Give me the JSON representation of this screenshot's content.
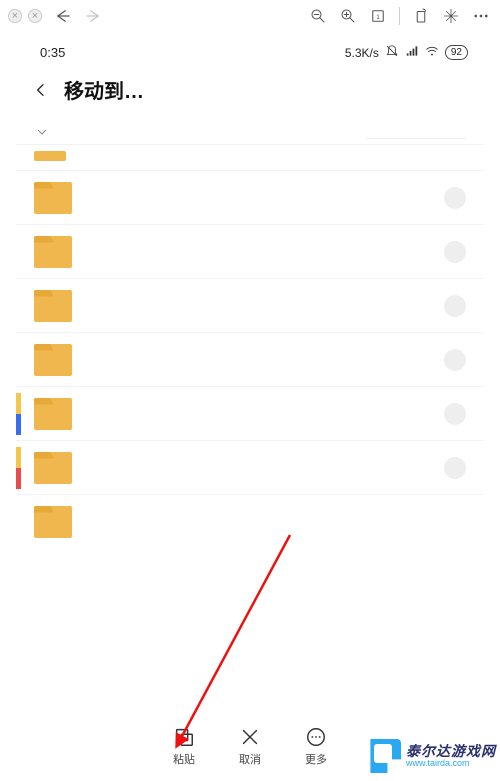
{
  "browserBar": {
    "closeTabs": [
      "×",
      "×"
    ]
  },
  "statusBar": {
    "time": "0:35",
    "netspeed": "5.3K/s",
    "battery": "92"
  },
  "header": {
    "title": "移动到…"
  },
  "folders": [
    {
      "type": "partial"
    },
    {
      "type": "full",
      "radio": true
    },
    {
      "type": "full",
      "radio": true
    },
    {
      "type": "full",
      "radio": true
    },
    {
      "type": "full",
      "radio": true
    },
    {
      "type": "full",
      "radio": true,
      "stripe": true
    },
    {
      "type": "full",
      "radio": true
    },
    {
      "type": "full",
      "radio": false
    }
  ],
  "bottomBar": {
    "paste": "粘贴",
    "cancel": "取消",
    "more": "更多"
  },
  "watermark": {
    "name": "泰尔达游戏网",
    "url": "www.tairda.com"
  }
}
